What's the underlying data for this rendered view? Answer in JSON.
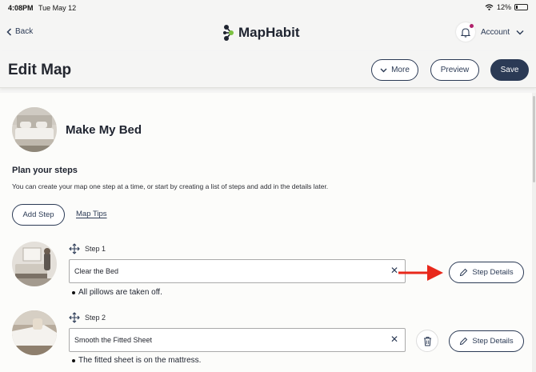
{
  "status": {
    "time": "4:08PM",
    "date": "Tue May 12",
    "battery": "12%"
  },
  "nav": {
    "back_label": "Back",
    "logo_text": "MapHabit",
    "account_label": "Account"
  },
  "header": {
    "title": "Edit Map",
    "more_label": "More",
    "preview_label": "Preview",
    "save_label": "Save"
  },
  "map": {
    "title": "Make My Bed"
  },
  "plan": {
    "title": "Plan your steps",
    "description": "You can create your map one step at a time, or start by creating a list of steps and add in the details later.",
    "add_step_label": "Add Step",
    "map_tips_label": "Map Tips"
  },
  "steps": [
    {
      "label": "Step 1",
      "value": "Clear the Bed",
      "detail": "All pillows are taken off.",
      "details_label": "Step Details"
    },
    {
      "label": "Step 2",
      "value": "Smooth the Fitted Sheet",
      "detail": "The fitted sheet is on the mattress.",
      "details_label": "Step Details"
    }
  ],
  "colors": {
    "primary": "#2b3a55",
    "background": "#f5f5f4",
    "card": "#fcfcfa",
    "notification_dot": "#b0206a",
    "annotation_arrow": "#e8281b"
  },
  "icons": {
    "back": "chevron-left-icon",
    "bell": "bell-icon",
    "account_chevron": "chevron-down-icon",
    "more_chevron": "chevron-down-icon",
    "drag": "move-icon",
    "clear": "close-icon",
    "trash": "trash-icon",
    "pencil": "pencil-icon"
  }
}
